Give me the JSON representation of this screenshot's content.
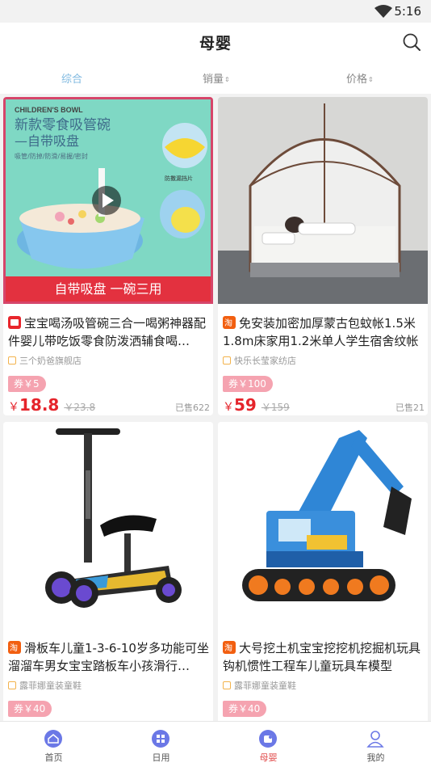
{
  "status": {
    "time": "5:16"
  },
  "header": {
    "title": "母婴"
  },
  "sort": {
    "tabs": [
      "综合",
      "销量",
      "价格"
    ],
    "arrow": "⇕"
  },
  "thumb_text": {
    "bowl_brand": "CHILDREN'S BOWL",
    "bowl_line1": "新款零食吸管碗",
    "bowl_line2": "—自带吸盘",
    "bowl_line3": "吸管/防掉/防滑/易握/密封",
    "bowl_tag": "防撒漏挡片",
    "bowl_banner": "自带吸盘  一碗三用"
  },
  "products": [
    {
      "name": "宝宝喝汤吸管碗三合一喝粥神器配件婴儿带吃饭零食防泼洒辅食喝…",
      "shop": "三个奶爸旗舰店",
      "coupon": "券￥5",
      "yen": "￥",
      "price": "18.8",
      "orig": "￥23.8",
      "sold": "已售622"
    },
    {
      "name": "免安装加密加厚蒙古包蚊帐1.5米1.8m床家用1.2米单人学生宿舍纹帐",
      "shop": "快乐长莹家纺店",
      "coupon": "券￥100",
      "yen": "￥",
      "price": "59",
      "orig": "￥159",
      "sold": "已售21"
    },
    {
      "name": "滑板车儿童1-3-6-10岁多功能可坐溜溜车男女宝宝踏板车小孩滑行…",
      "shop": "露菲娜童装童鞋",
      "coupon": "券￥40",
      "yen": "",
      "price": "",
      "orig": "",
      "sold": ""
    },
    {
      "name": "大号挖土机宝宝挖挖机挖掘机玩具钩机惯性工程车儿童玩具车模型",
      "shop": "露菲娜童装童鞋",
      "coupon": "券￥40",
      "yen": "",
      "price": "",
      "orig": "",
      "sold": ""
    }
  ],
  "tabbar": {
    "items": [
      "首页",
      "日用",
      "母婴",
      "我的"
    ],
    "active": 2
  },
  "colors": {
    "accent": "#7fb9e0",
    "price": "#e5242b",
    "coupon": "#f5a3b0",
    "tab_active": "#e04a4a",
    "tab_icon": "#6b78e6"
  },
  "icons": [
    "wifi-icon",
    "search-icon",
    "play-icon",
    "tmall-icon",
    "taobao-icon",
    "shop-icon",
    "home-icon",
    "grid-icon",
    "baby-icon",
    "user-icon"
  ]
}
